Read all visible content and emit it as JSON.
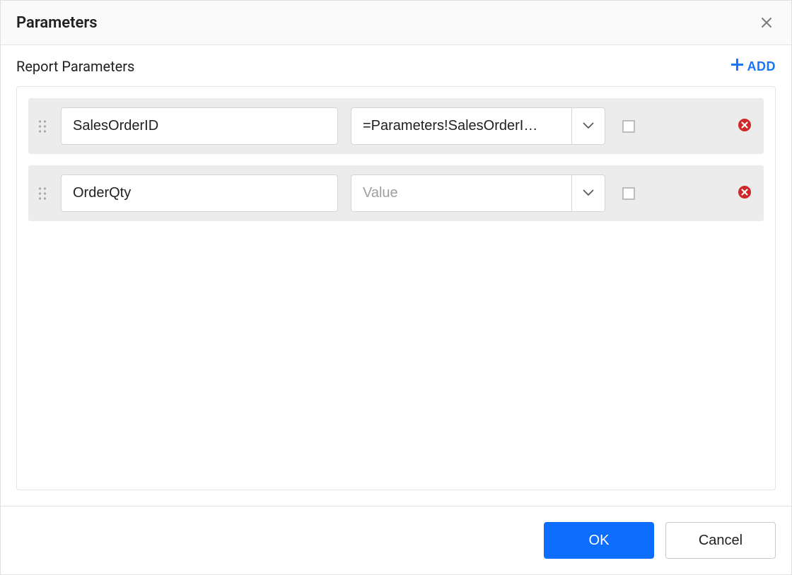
{
  "dialog": {
    "title": "Parameters"
  },
  "section": {
    "subtitle": "Report Parameters",
    "add_label": "ADD"
  },
  "rows": [
    {
      "name": "SalesOrderID",
      "value": "=Parameters!SalesOrderI…",
      "value_placeholder": "Value",
      "checked": false
    },
    {
      "name": "OrderQty",
      "value": "",
      "value_placeholder": "Value",
      "checked": false
    }
  ],
  "footer": {
    "ok_label": "OK",
    "cancel_label": "Cancel"
  }
}
